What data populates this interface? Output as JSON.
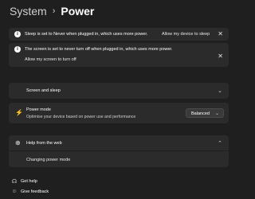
{
  "breadcrumb": {
    "parent": "System",
    "separator": "›",
    "current": "Power"
  },
  "notices": [
    {
      "text": "Sleep is set to Never when plugged in, which uses more power.",
      "action": "Allow my device to sleep"
    },
    {
      "text": "The screen is set to never turn off when plugged in, which uses more power.",
      "action": "Allow my screen to turn off"
    }
  ],
  "screen_and_sleep": {
    "label": "Screen and sleep"
  },
  "power_mode": {
    "title": "Power mode",
    "description": "Optimise your device based on power use and performance",
    "value": "Balanced"
  },
  "help": {
    "label": "Help from the web",
    "link": "Changing power mode"
  },
  "footer": {
    "get_help": "Get help",
    "give_feedback": "Give feedback"
  }
}
